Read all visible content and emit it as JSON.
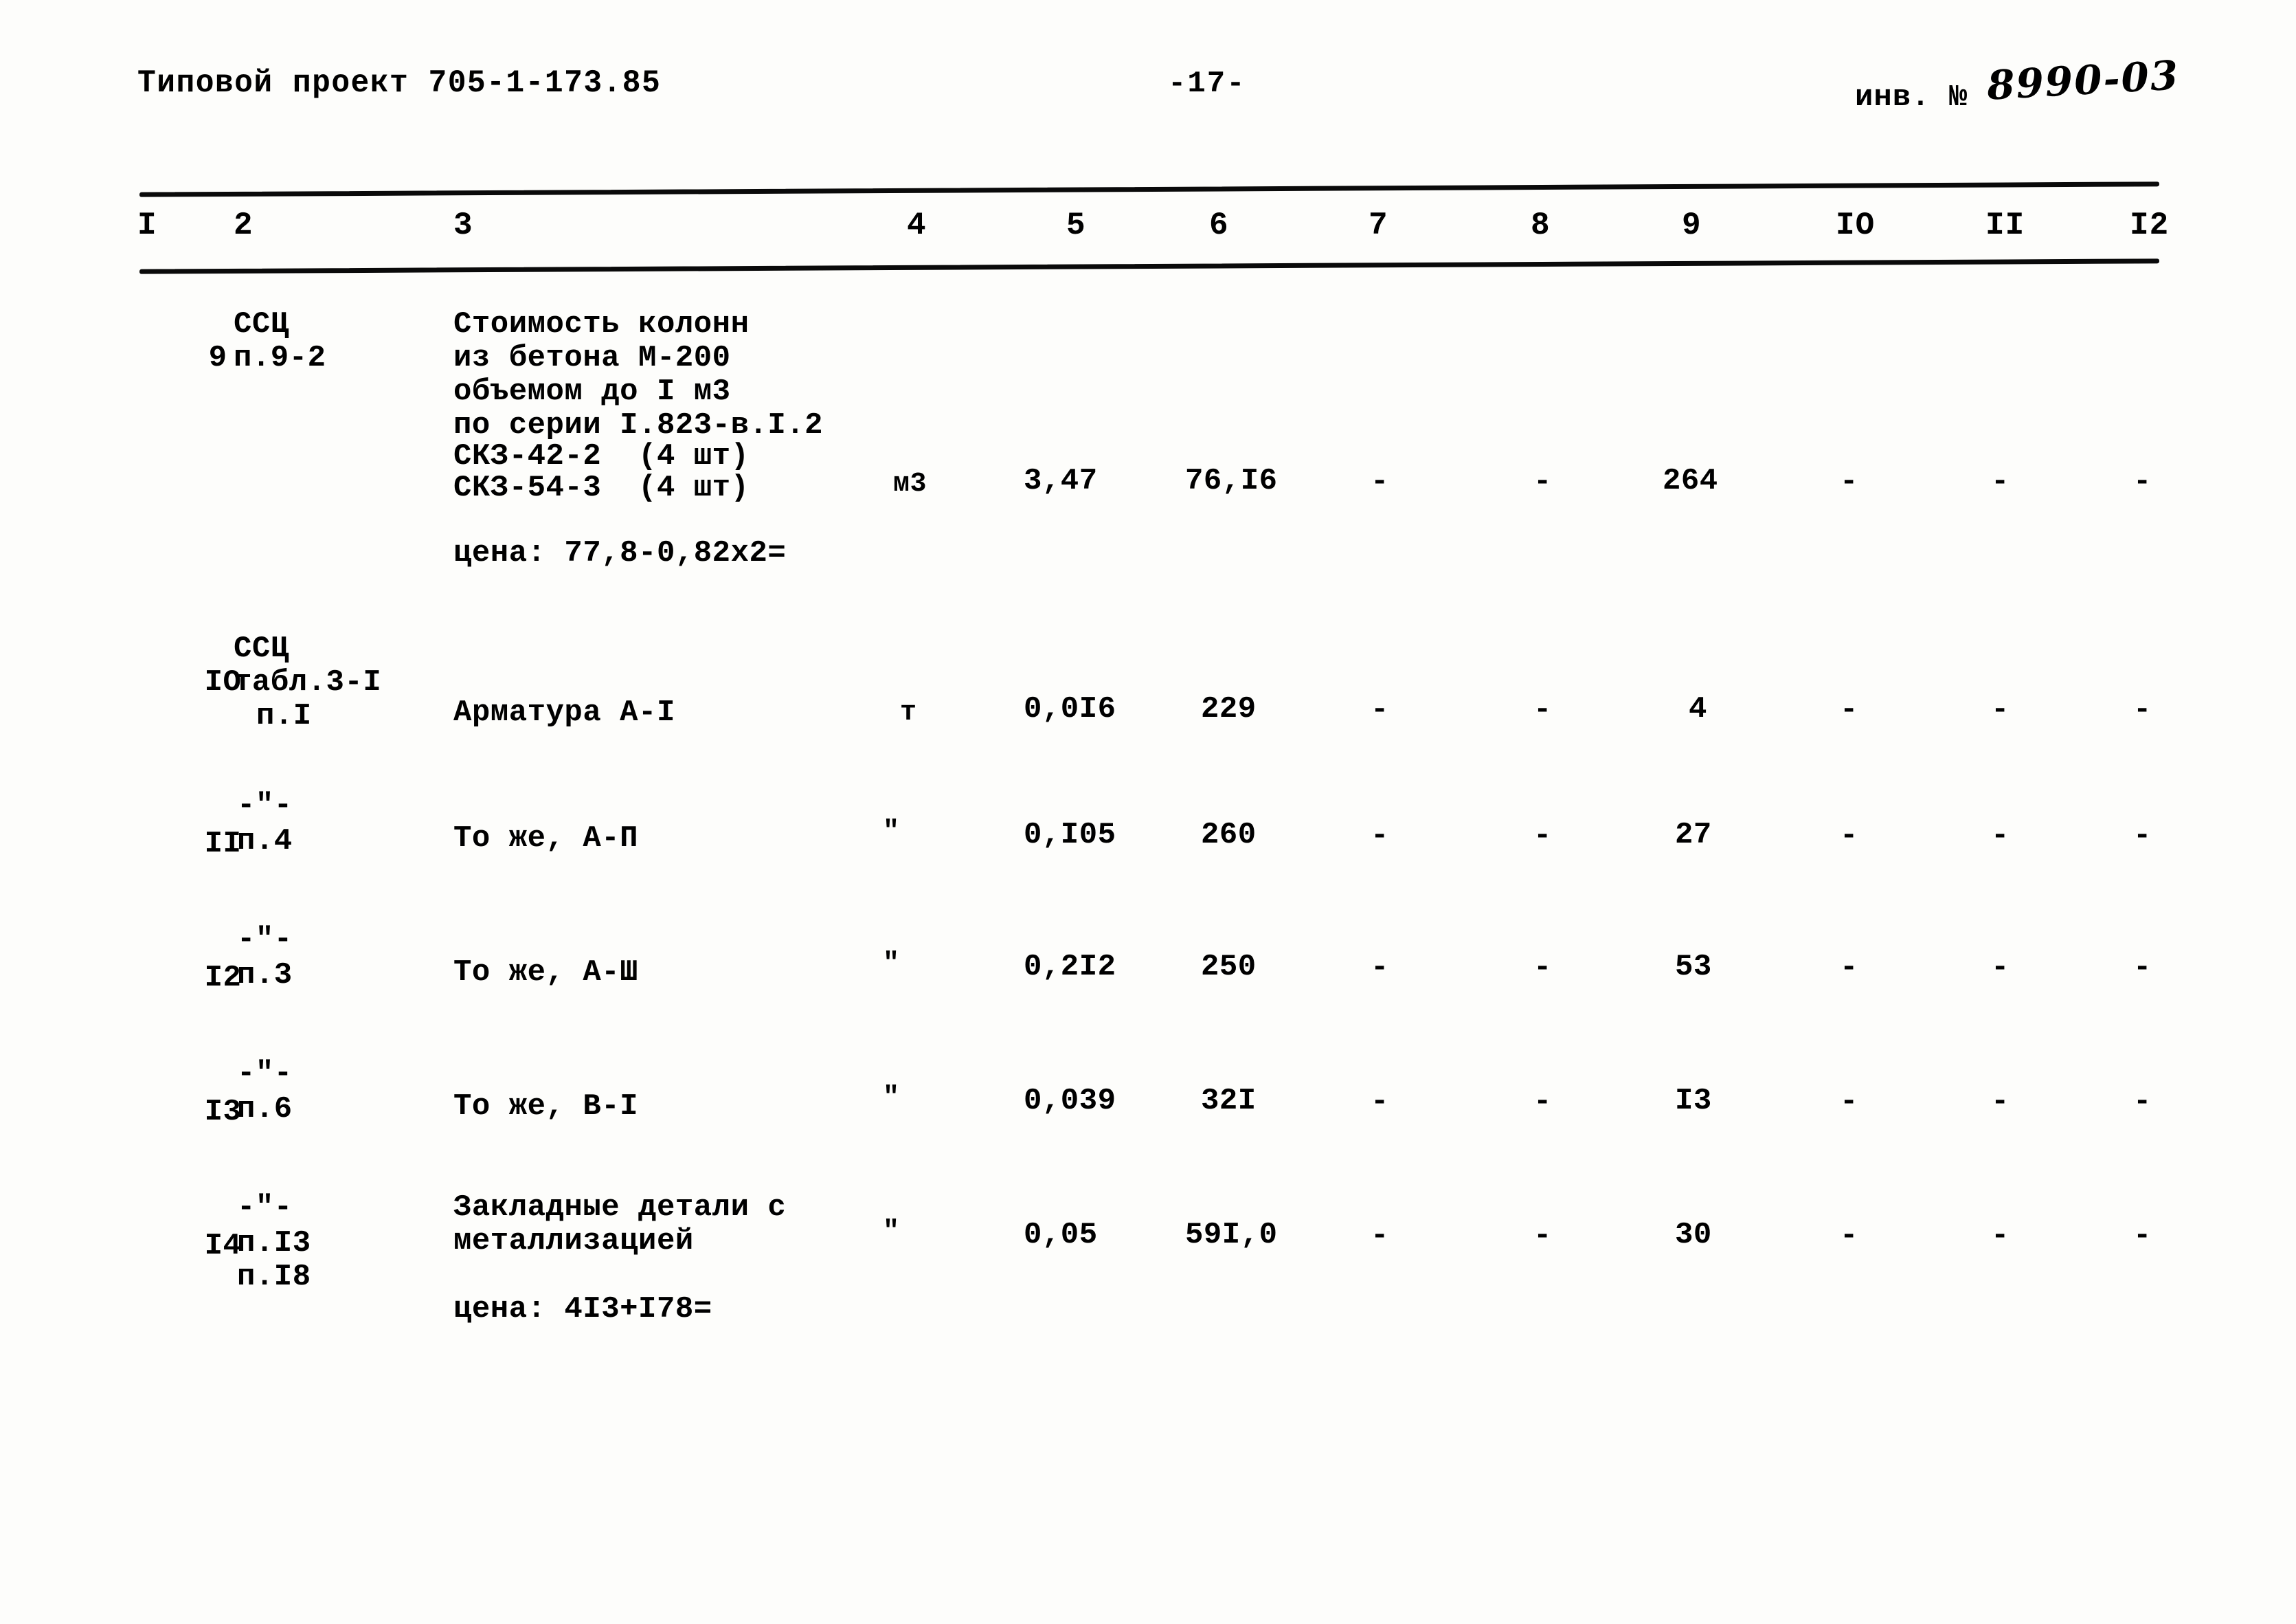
{
  "header": {
    "project_label": "Типовой проект 705-1-173.85",
    "page_number": "-17-",
    "inventory_label": "инв. №",
    "inventory_number": "8990-03"
  },
  "table": {
    "column_headers": [
      "I",
      "2",
      "3",
      "4",
      "5",
      "6",
      "7",
      "8",
      "9",
      "IO",
      "II",
      "I2"
    ],
    "rows": [
      {
        "c1": "9",
        "c2_lines": [
          "ССЦ",
          "п.9-2"
        ],
        "c3_lines": [
          "Стоимость колонн",
          "из бетона М-200",
          "объемом до I м3",
          "по серии I.823-в.I.2",
          "СКЗ-42-2  (4 шт)",
          "СКЗ-54-3  (4 шт)"
        ],
        "c3_note": "цена: 77,8-0,82х2=",
        "c4": "м3",
        "c5": "3,47",
        "c6": "76,I6",
        "c7": "-",
        "c8": "-",
        "c9": "264",
        "c10": "-",
        "c11": "-",
        "c12": "-"
      },
      {
        "c1": "IO",
        "c2_lines": [
          "ССЦ",
          "табл.3-I",
          "п.I"
        ],
        "c3_lines": [
          "Арматура А-I"
        ],
        "c3_note": "",
        "c4": "т",
        "c5": "0,0I6",
        "c6": "229",
        "c7": "-",
        "c8": "-",
        "c9": "4",
        "c10": "-",
        "c11": "-",
        "c12": "-"
      },
      {
        "c1": "II",
        "c2_lines": [
          "-\"-",
          "п.4"
        ],
        "c3_lines": [
          "То же, А-П"
        ],
        "c3_note": "",
        "c4": "\"",
        "c5": "0,I05",
        "c6": "260",
        "c7": "-",
        "c8": "-",
        "c9": "27",
        "c10": "-",
        "c11": "-",
        "c12": "-"
      },
      {
        "c1": "I2",
        "c2_lines": [
          "-\"-",
          "п.3"
        ],
        "c3_lines": [
          "То же, А-Ш"
        ],
        "c3_note": "",
        "c4": "\"",
        "c5": "0,2I2",
        "c6": "250",
        "c7": "-",
        "c8": "-",
        "c9": "53",
        "c10": "-",
        "c11": "-",
        "c12": "-"
      },
      {
        "c1": "I3",
        "c2_lines": [
          "-\"-",
          "п.6"
        ],
        "c3_lines": [
          "То же, В-I"
        ],
        "c3_note": "",
        "c4": "\"",
        "c5": "0,039",
        "c6": "32I",
        "c7": "-",
        "c8": "-",
        "c9": "I3",
        "c10": "-",
        "c11": "-",
        "c12": "-"
      },
      {
        "c1": "I4",
        "c2_lines": [
          "-\"-",
          "п.I3",
          "п.I8"
        ],
        "c3_lines": [
          "Закладные детали с",
          "металлизацией"
        ],
        "c3_note": "цена: 4I3+I78=",
        "c4": "\"",
        "c5": "0,05",
        "c6": "59I,0",
        "c7": "-",
        "c8": "-",
        "c9": "30",
        "c10": "-",
        "c11": "-",
        "c12": "-"
      }
    ]
  }
}
